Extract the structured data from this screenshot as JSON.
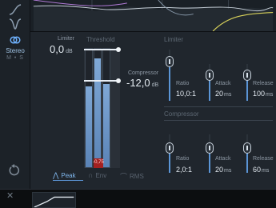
{
  "limiter": {
    "label": "Limiter",
    "value": "0,0",
    "unit": "dB"
  },
  "threshold": {
    "label": "Threshold",
    "peak_readout": "-0,75"
  },
  "compressor": {
    "label": "Compressor",
    "value": "-12,0",
    "unit": "dB"
  },
  "stereo": {
    "label": "Stereo",
    "sub": "M • S"
  },
  "limiter_section": {
    "title": "Limiter",
    "params": [
      {
        "name": "ratio",
        "label": "Ratio",
        "value": "10,0:1",
        "unit": ""
      },
      {
        "name": "attack",
        "label": "Attack",
        "value": "20",
        "unit": "ms"
      },
      {
        "name": "release",
        "label": "Release",
        "value": "100",
        "unit": "ms"
      }
    ]
  },
  "compressor_section": {
    "title": "Compressor",
    "params": [
      {
        "name": "ratio",
        "label": "Ratio",
        "value": "2,0:1",
        "unit": ""
      },
      {
        "name": "attack",
        "label": "Attack",
        "value": "20",
        "unit": "ms"
      },
      {
        "name": "release",
        "label": "Release",
        "value": "60",
        "unit": "ms"
      }
    ]
  },
  "detection_modes": [
    {
      "label": "Peak",
      "active": true
    },
    {
      "label": "Env",
      "active": false
    },
    {
      "label": "RMS",
      "active": false
    }
  ],
  "meter_levels": {
    "left": 0.68,
    "right": 0.7,
    "center": 0.92
  },
  "colors": {
    "accent": "#5b95d6",
    "meter": "#7fa8d6",
    "clip": "#a32020"
  }
}
